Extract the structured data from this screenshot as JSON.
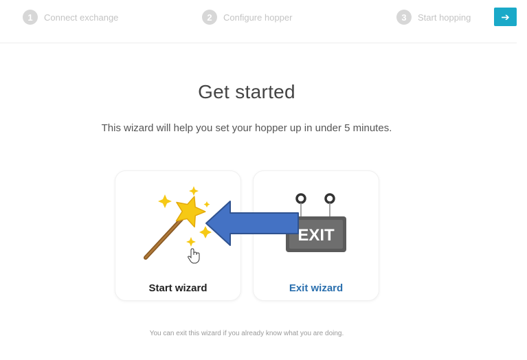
{
  "stepper": {
    "steps": [
      {
        "number": "1",
        "label": "Connect exchange"
      },
      {
        "number": "2",
        "label": "Configure hopper"
      },
      {
        "number": "3",
        "label": "Start hopping"
      }
    ],
    "next_icon": "arrow-right-icon",
    "next_color": "#1aa9c8"
  },
  "main": {
    "title": "Get started",
    "subtitle": "This wizard will help you set your hopper up in under 5 minutes.",
    "cards": [
      {
        "label": "Start wizard",
        "icon": "magic-wand-icon"
      },
      {
        "label": "Exit wizard",
        "icon": "exit-sign-icon",
        "sign_text": "EXIT"
      }
    ],
    "footnote": "You can exit this wizard if you already know what you are doing."
  },
  "colors": {
    "accent": "#1aa9c8",
    "link": "#2a6fae",
    "annotation_arrow": "#4472c4"
  }
}
